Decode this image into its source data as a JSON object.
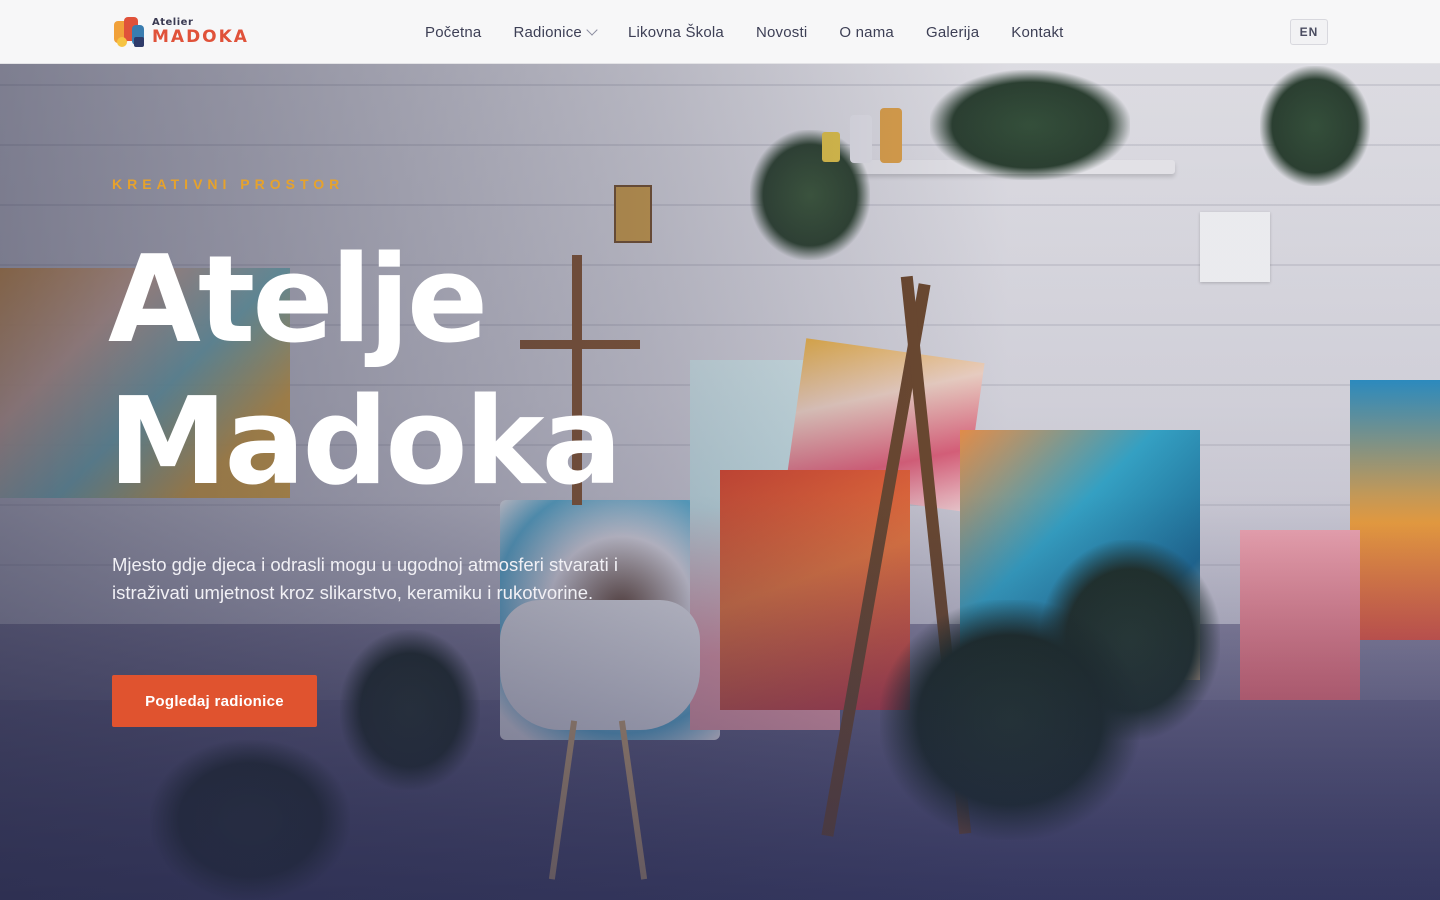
{
  "brand": {
    "logo_small": "Atelier",
    "logo_big": "MADOKA"
  },
  "nav": {
    "items": [
      {
        "label": "Početna"
      },
      {
        "label": "Radionice"
      },
      {
        "label": "Likovna Škola"
      },
      {
        "label": "Novosti"
      },
      {
        "label": "O nama"
      },
      {
        "label": "Galerija"
      },
      {
        "label": "Kontakt"
      }
    ],
    "language": "EN"
  },
  "hero": {
    "eyebrow": "KREATIVNI PROSTOR",
    "title_line1": "Atelje",
    "title_line2": "Madoka",
    "description": "Mjesto gdje djeca i odrasli mogu u ugodnoj atmosferi stvarati i istraživati umjetnost kroz slikarstvo, keramiku i rukotvorine.",
    "cta_label": "Pogledaj radionice"
  },
  "colors": {
    "accent": "#e0532f",
    "eyebrow": "#e6a22c",
    "brand_orange": "#e0523a",
    "nav_text": "#3d3f55"
  }
}
